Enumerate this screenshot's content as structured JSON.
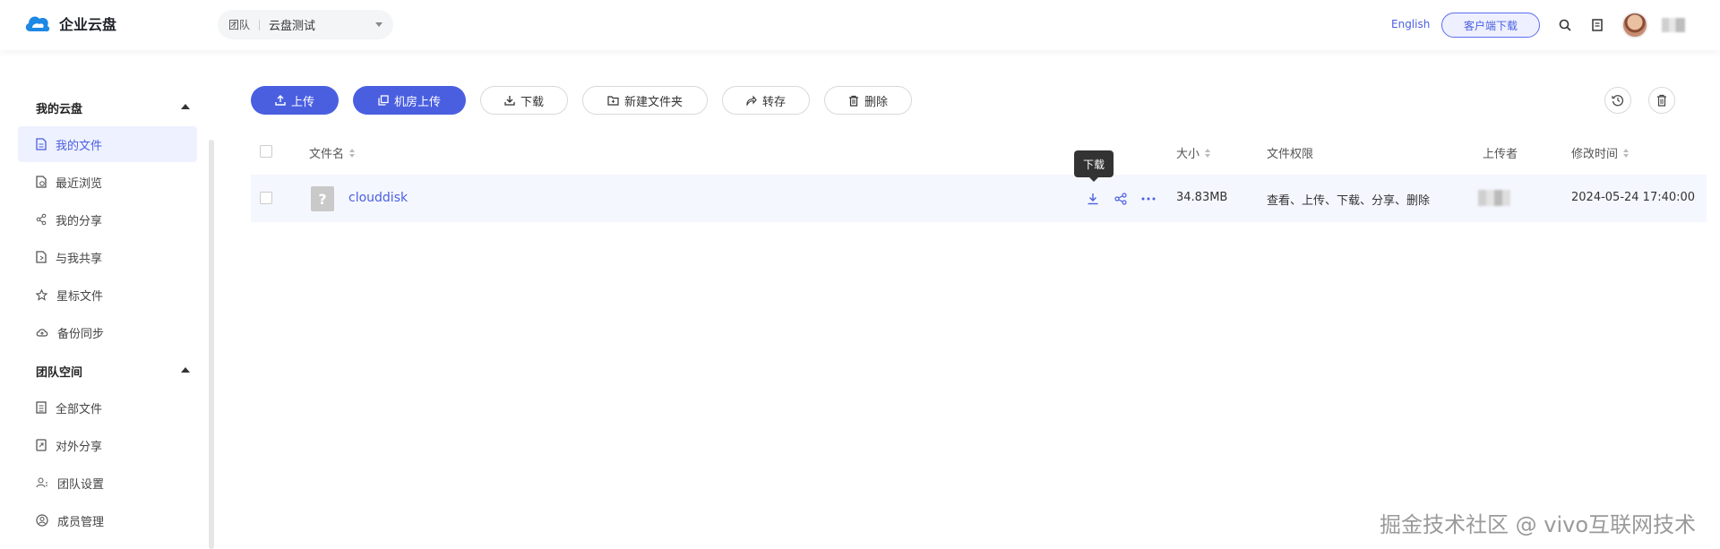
{
  "header": {
    "logo_text": "企业云盘",
    "team_select": {
      "tag": "团队",
      "value": "云盘测试"
    },
    "language": "English",
    "client_download": "客户端下载",
    "icons": [
      "search-icon",
      "document-icon"
    ]
  },
  "sidebar": {
    "my_disk": {
      "title": "我的云盘",
      "items": [
        {
          "label": "我的文件",
          "icon": "file-icon",
          "active": true
        },
        {
          "label": "最近浏览",
          "icon": "recent-file-icon"
        },
        {
          "label": "我的分享",
          "icon": "share-icon"
        },
        {
          "label": "与我共享",
          "icon": "shared-with-me-icon"
        },
        {
          "label": "星标文件",
          "icon": "star-icon"
        },
        {
          "label": "备份同步",
          "icon": "cloud-sync-icon"
        }
      ]
    },
    "team_space": {
      "title": "团队空间",
      "items": [
        {
          "label": "全部文件",
          "icon": "all-files-icon"
        },
        {
          "label": "对外分享",
          "icon": "external-share-icon"
        },
        {
          "label": "团队设置",
          "icon": "team-settings-icon"
        },
        {
          "label": "成员管理",
          "icon": "member-icon"
        }
      ]
    }
  },
  "toolbar": {
    "upload": "上传",
    "machine_upload": "机房上传",
    "download": "下载",
    "new_folder": "新建文件夹",
    "transfer": "转存",
    "delete": "删除"
  },
  "table": {
    "headers": {
      "name": "文件名",
      "size": "大小",
      "permission": "文件权限",
      "uploader": "上传者",
      "modified": "修改时间"
    },
    "rows": [
      {
        "name": "clouddisk",
        "size": "34.83MB",
        "permission": "查看、上传、下载、分享、删除",
        "modified": "2024-05-24 17:40:00"
      }
    ]
  },
  "tooltip": "下载",
  "watermark": "掘金技术社区 @ vivo互联网技术",
  "colors": {
    "primary": "#4a5fe0",
    "row_highlight": "#f5f7ff"
  }
}
